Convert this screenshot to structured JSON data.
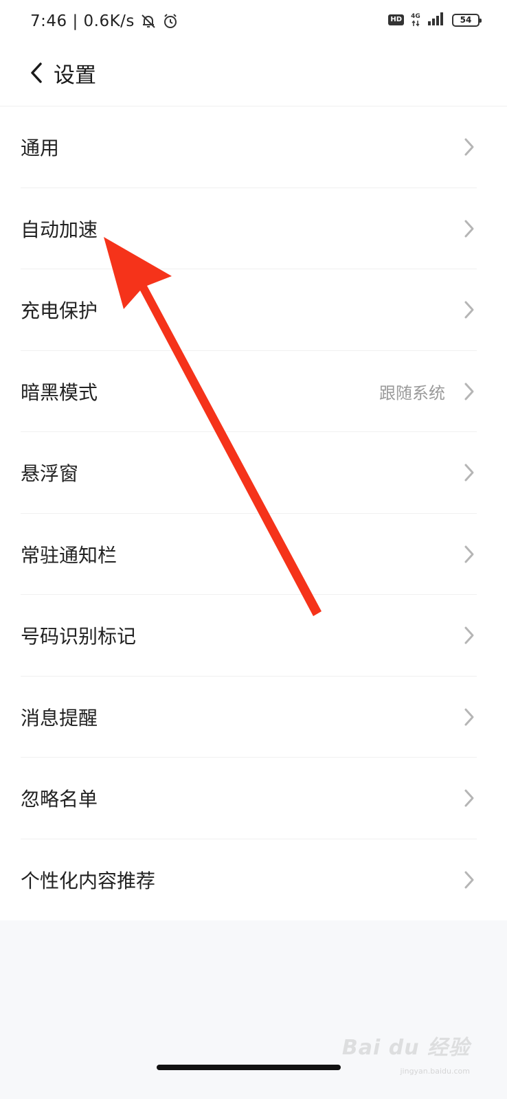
{
  "status_bar": {
    "time": "7:46 | 0.6K/s",
    "hd_label": "HD",
    "network_label": "4G",
    "battery_level": "54"
  },
  "header": {
    "title": "设置"
  },
  "settings": {
    "items": [
      {
        "label": "通用",
        "value": ""
      },
      {
        "label": "自动加速",
        "value": ""
      },
      {
        "label": "充电保护",
        "value": ""
      },
      {
        "label": "暗黑模式",
        "value": "跟随系统"
      },
      {
        "label": "悬浮窗",
        "value": ""
      },
      {
        "label": "常驻通知栏",
        "value": ""
      },
      {
        "label": "号码识别标记",
        "value": ""
      },
      {
        "label": "消息提醒",
        "value": ""
      },
      {
        "label": "忽略名单",
        "value": ""
      },
      {
        "label": "个性化内容推荐",
        "value": ""
      }
    ]
  },
  "annotation": {
    "arrow_color": "#f5331a"
  },
  "watermark": {
    "text": "Bai du 经验",
    "sub": "jingyan.baidu.com"
  },
  "colors": {
    "background": "#f7f8fa",
    "surface": "#ffffff",
    "text": "#222222",
    "secondary": "#9a9a9a",
    "chevron": "#b5b5b5"
  }
}
